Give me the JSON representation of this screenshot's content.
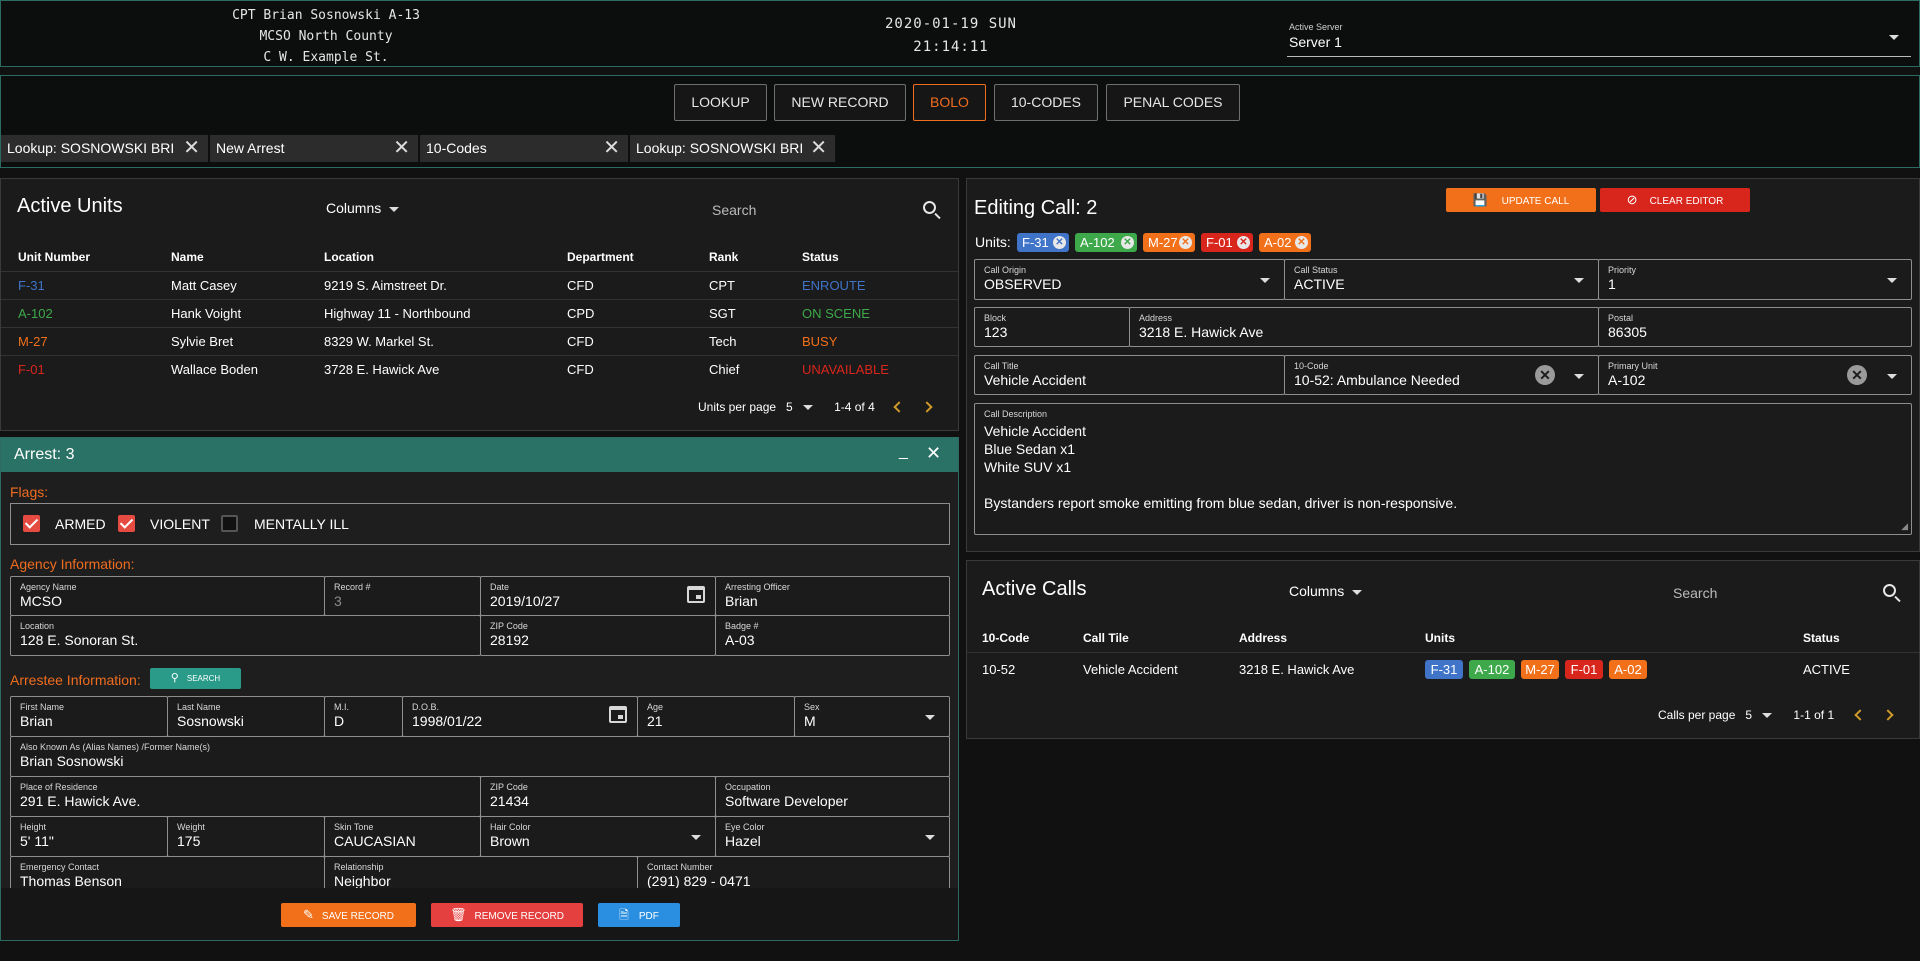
{
  "header": {
    "officer_line1": "CPT Brian Sosnowski A-13",
    "officer_line2": "MCSO North County",
    "officer_line3": "C W. Example St.",
    "date": "2020-01-19 SUN",
    "time": "21:14:11",
    "server_label": "Active Server",
    "server_value": "Server 1"
  },
  "nav": {
    "buttons": [
      "LOOKUP",
      "NEW RECORD",
      "BOLO",
      "10-CODES",
      "PENAL CODES"
    ],
    "active": "BOLO",
    "tabs": [
      "Lookup: SOSNOWSKI BRI",
      "New Arrest",
      "10-Codes",
      "Lookup: SOSNOWSKI BRI"
    ]
  },
  "active_units": {
    "title": "Active Units",
    "columns_label": "Columns",
    "search_placeholder": "Search",
    "headers": [
      "Unit Number",
      "Name",
      "Location",
      "Department",
      "Rank",
      "Status"
    ],
    "rows": [
      {
        "unit": "F-31",
        "name": "Matt Casey",
        "location": "9219 S. Aimstreet Dr.",
        "dept": "CFD",
        "rank": "CPT",
        "status": "ENROUTE",
        "color": "#3f74c9"
      },
      {
        "unit": "A-102",
        "name": "Hank Voight",
        "location": "Highway 11 - Northbound",
        "dept": "CPD",
        "rank": "SGT",
        "status": "ON SCENE",
        "color": "#3ea94a"
      },
      {
        "unit": "M-27",
        "name": "Sylvie Bret",
        "location": "8329 W. Markel St.",
        "dept": "CFD",
        "rank": "Tech",
        "status": "BUSY",
        "color": "#f27019"
      },
      {
        "unit": "F-01",
        "name": "Wallace Boden",
        "location": "3728 E. Hawick Ave",
        "dept": "CFD",
        "rank": "Chief",
        "status": "UNAVAILABLE",
        "color": "#d9261c"
      }
    ],
    "per_page_label": "Units per page",
    "per_page": "5",
    "range": "1-4 of 4"
  },
  "arrest": {
    "title": "Arrest: 3",
    "flags_label": "Flags:",
    "flags": [
      {
        "label": "ARMED",
        "checked": true
      },
      {
        "label": "VIOLENT",
        "checked": true
      },
      {
        "label": "MENTALLY ILL",
        "checked": false
      }
    ],
    "agency_label": "Agency Information:",
    "agency": {
      "agency_name_label": "Agency Name",
      "agency_name": "MCSO",
      "record_label": "Record #",
      "record": "3",
      "date_label": "Date",
      "date": "2019/10/27",
      "officer_label": "Arresting Officer",
      "officer": "Brian",
      "location_label": "Location",
      "location": "128 E. Sonoran St.",
      "zip_label": "ZIP Code",
      "zip": "28192",
      "badge_label": "Badge #",
      "badge": "A-03"
    },
    "arrestee_label": "Arrestee Information:",
    "search_button": "SEARCH",
    "arrestee": {
      "first_label": "First Name",
      "first": "Brian",
      "last_label": "Last Name",
      "last": "Sosnowski",
      "mi_label": "M.I.",
      "mi": "D",
      "dob_label": "D.O.B.",
      "dob": "1998/01/22",
      "age_label": "Age",
      "age": "21",
      "sex_label": "Sex",
      "sex": "M",
      "aka_label": "Also Known As (Alias Names) /Former Name(s)",
      "aka": "Brian Sosnowski",
      "residence_label": "Place of Residence",
      "residence": "291 E. Hawick Ave.",
      "zip_label": "ZIP Code",
      "zip": "21434",
      "occupation_label": "Occupation",
      "occupation": "Software Developer",
      "height_label": "Height",
      "height": "5' 11\"",
      "weight_label": "Weight",
      "weight": "175",
      "skin_label": "Skin Tone",
      "skin": "CAUCASIAN",
      "hair_label": "Hair Color",
      "hair": "Brown",
      "eye_label": "Eye Color",
      "eye": "Hazel",
      "contact_label": "Emergency Contact",
      "contact": "Thomas Benson",
      "relationship_label": "Relationship",
      "relationship": "Neighbor",
      "phone_label": "Contact Number",
      "phone": "(291) 829 - 0471"
    },
    "save_button": "SAVE RECORD",
    "remove_button": "REMOVE RECORD",
    "pdf_button": "PDF"
  },
  "editing_call": {
    "title": "Editing Call: 2",
    "update_button": "UPDATE CALL",
    "clear_button": "CLEAR EDITOR",
    "units_label": "Units:",
    "units": [
      {
        "id": "F-31",
        "color": "#3f74c9"
      },
      {
        "id": "A-102",
        "color": "#3ea94a"
      },
      {
        "id": "M-27",
        "color": "#f27019"
      },
      {
        "id": "F-01",
        "color": "#d9261c"
      },
      {
        "id": "A-02",
        "color": "#f27019"
      }
    ],
    "origin_label": "Call Origin",
    "origin": "OBSERVED",
    "status_label": "Call Status",
    "status": "ACTIVE",
    "priority_label": "Priority",
    "priority": "1",
    "block_label": "Block",
    "block": "123",
    "address_label": "Address",
    "address": "3218 E. Hawick Ave",
    "postal_label": "Postal",
    "postal": "86305",
    "call_title_label": "Call Title",
    "call_title": "Vehicle Accident",
    "code_label": "10-Code",
    "code": "10-52: Ambulance Needed",
    "primary_label": "Primary Unit",
    "primary": "A-102",
    "desc_label": "Call Description",
    "desc_lines": [
      "Vehicle Accident",
      "Blue Sedan x1",
      "White SUV x1",
      "",
      "Bystanders report smoke emitting from blue sedan, driver is non-responsive."
    ]
  },
  "active_calls": {
    "title": "Active Calls",
    "columns_label": "Columns",
    "search_placeholder": "Search",
    "headers": [
      "10-Code",
      "Call Tile",
      "Address",
      "Units",
      "Status"
    ],
    "rows": [
      {
        "code": "10-52",
        "title": "Vehicle Accident",
        "address": "3218 E. Hawick Ave",
        "status": "ACTIVE",
        "units": [
          {
            "id": "F-31",
            "color": "#3f74c9"
          },
          {
            "id": "A-102",
            "color": "#3ea94a"
          },
          {
            "id": "M-27",
            "color": "#f27019"
          },
          {
            "id": "F-01",
            "color": "#d9261c"
          },
          {
            "id": "A-02",
            "color": "#f27019"
          }
        ]
      }
    ],
    "per_page_label": "Calls per page",
    "per_page": "5",
    "range": "1-1 of 1"
  }
}
